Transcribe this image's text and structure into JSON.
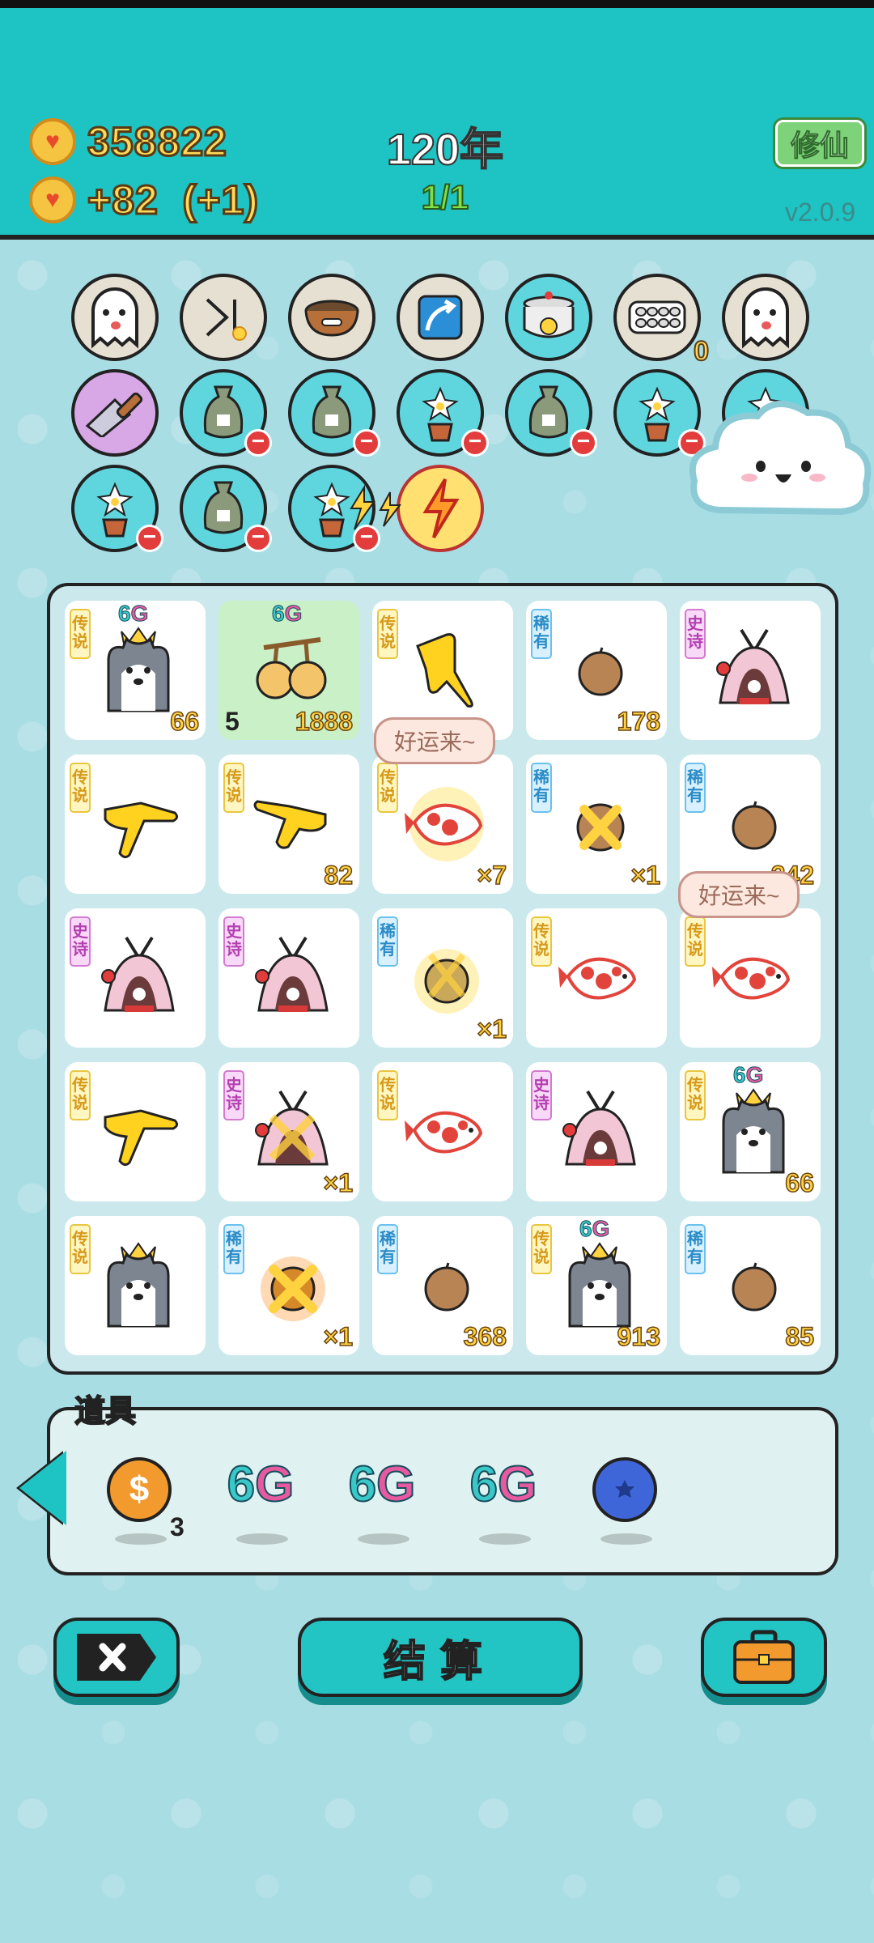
{
  "header": {
    "coins": "358822",
    "income": "+82  (+1)",
    "year": "120年",
    "level": "1/1",
    "cultivate_label": "修仙",
    "version": "v2.0.9"
  },
  "grid": {
    "cells": [
      {
        "tag": "传说",
        "rarity": "legend",
        "badge": "6G",
        "icon": "husky-crown",
        "value": "66"
      },
      {
        "tag": "",
        "rarity": "",
        "badge": "6G",
        "icon": "golden-fruits",
        "left": "5",
        "value": "1888",
        "highlight": true
      },
      {
        "tag": "传说",
        "rarity": "legend",
        "icon": "pointing-hand-down",
        "value": ""
      },
      {
        "tag": "稀有",
        "rarity": "rare",
        "icon": "nut",
        "value": "178"
      },
      {
        "tag": "史诗",
        "rarity": "epic",
        "icon": "rabbit-tent",
        "value": ""
      },
      {
        "tag": "传说",
        "rarity": "legend",
        "icon": "pointing-hand",
        "value": ""
      },
      {
        "tag": "传说",
        "rarity": "legend",
        "icon": "pointing-hand-left",
        "value": "82"
      },
      {
        "tag": "传说",
        "rarity": "legend",
        "icon": "koi-glow",
        "value": "×7"
      },
      {
        "tag": "稀有",
        "rarity": "rare",
        "icon": "nut-x",
        "value": "×1"
      },
      {
        "tag": "稀有",
        "rarity": "rare",
        "icon": "nut",
        "value": "242"
      },
      {
        "tag": "史诗",
        "rarity": "epic",
        "icon": "rabbit-tent",
        "value": ""
      },
      {
        "tag": "史诗",
        "rarity": "epic",
        "icon": "rabbit-tent",
        "value": ""
      },
      {
        "tag": "稀有",
        "rarity": "rare",
        "icon": "nut-glow",
        "value": "×1"
      },
      {
        "tag": "传说",
        "rarity": "legend",
        "icon": "koi",
        "value": ""
      },
      {
        "tag": "传说",
        "rarity": "legend",
        "icon": "koi",
        "value": ""
      },
      {
        "tag": "传说",
        "rarity": "legend",
        "icon": "pointing-hand",
        "value": ""
      },
      {
        "tag": "史诗",
        "rarity": "epic",
        "icon": "rabbit-tent-x",
        "value": "×1"
      },
      {
        "tag": "传说",
        "rarity": "legend",
        "icon": "koi",
        "value": ""
      },
      {
        "tag": "史诗",
        "rarity": "epic",
        "icon": "rabbit-tent",
        "value": ""
      },
      {
        "tag": "传说",
        "rarity": "legend",
        "badge": "6G",
        "icon": "husky-crown",
        "value": "66"
      },
      {
        "tag": "传说",
        "rarity": "legend",
        "icon": "husky-crown",
        "value": ""
      },
      {
        "tag": "稀有",
        "rarity": "rare",
        "icon": "nut-x-glow",
        "value": "×1"
      },
      {
        "tag": "稀有",
        "rarity": "rare",
        "icon": "nut",
        "value": "368"
      },
      {
        "tag": "传说",
        "rarity": "legend",
        "badge": "6G",
        "icon": "husky-crown",
        "value": "913"
      },
      {
        "tag": "稀有",
        "rarity": "rare",
        "icon": "nut",
        "value": "85"
      }
    ],
    "bubble_text": "好运来~"
  },
  "top_icons": {
    "row1_count": "0"
  },
  "tools": {
    "title": "道具",
    "coin_count": "3",
    "g6_label": "6G"
  },
  "buttons": {
    "settle_label": "结算"
  },
  "colors": {
    "header": "#1ec3c3",
    "background": "#a9dde4",
    "accent_gold": "#ffd23f"
  }
}
